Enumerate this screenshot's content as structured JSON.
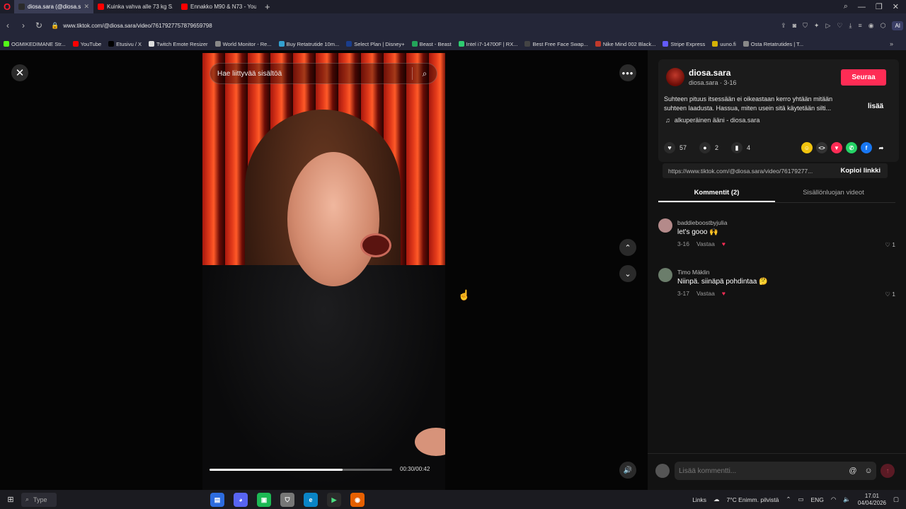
{
  "browser": {
    "tabs": [
      {
        "label": "diosa.sara (@diosa.sa",
        "active": true,
        "color": "#2b2b2b"
      },
      {
        "label": "Kuinka vahva alle 73 kg S...",
        "active": false,
        "color": "#ff0000"
      },
      {
        "label": "Ennakko M90 & N73 - You",
        "active": false,
        "color": "#ff0000"
      }
    ],
    "url": "www.tiktok.com/@diosa.sara/video/7617927757879659798",
    "ai_label": "AI",
    "bookmarks": [
      {
        "label": "OGMIKEDIMANE Str...",
        "color": "#53fc18"
      },
      {
        "label": "YouTube",
        "color": "#ff0000"
      },
      {
        "label": "Etusivu / X",
        "color": "#000000"
      },
      {
        "label": "Twitch Emote Resizer",
        "color": "#dddddd"
      },
      {
        "label": "World Monitor - Re...",
        "color": "#888888"
      },
      {
        "label": "Buy Retatrutide 10m...",
        "color": "#33a0d0"
      },
      {
        "label": "Select Plan | Disney+",
        "color": "#1a3d8c"
      },
      {
        "label": "Beast - Beast",
        "color": "#23a55a"
      },
      {
        "label": "Intel i7-14700F | RX...",
        "color": "#2ecc71"
      },
      {
        "label": "Best Free Face Swap...",
        "color": "#444444"
      },
      {
        "label": "Nike Mind 002 Black...",
        "color": "#c0392b"
      },
      {
        "label": "Stripe Express",
        "color": "#635bff"
      },
      {
        "label": "uuno.fi",
        "color": "#d4b106"
      },
      {
        "label": "Osta Retatrutides | T...",
        "color": "#888888"
      }
    ]
  },
  "viewer": {
    "search_placeholder": "Hae liittyvää sisältöä",
    "timecode": "00:30/00:42",
    "progress_fraction": 0.73
  },
  "author": {
    "name": "diosa.sara",
    "meta": "diosa.sara · 3-16",
    "follow_label": "Seuraa",
    "description": "Suhteen pituus itsessään ei oikeastaan kerro yhtään mitään suhteen laadusta. Hassua, miten usein sitä käytetään silti...",
    "more_label": "lisää",
    "sound": "alkuperäinen ääni - diosa.sara"
  },
  "stats": {
    "likes": "57",
    "comments": "2",
    "saves": "4"
  },
  "share": {
    "url": "https://www.tiktok.com/@diosa.sara/video/76179277...",
    "copy_label": "Kopioi linkki"
  },
  "panel_tabs": {
    "comments": "Kommentit (2)",
    "creator_videos": "Sisällönluojan videot"
  },
  "comments": [
    {
      "user": "baddieboostbyjulia",
      "text": "let's gooo 🙌",
      "date": "3-16",
      "reply": "Vastaa",
      "likes": "1",
      "avatar_color": "#b48a8a"
    },
    {
      "user": "Timo Mäklin",
      "text": "Niinpä. siinäpä pohdintaa 🤔",
      "date": "3-17",
      "reply": "Vastaa",
      "likes": "1",
      "avatar_color": "#6b7d6b"
    }
  ],
  "comment_input": {
    "placeholder": "Lisää kommentti..."
  },
  "taskbar": {
    "search": "Type",
    "links": "Links",
    "weather": "7°C  Enimm. pilvistä",
    "lang": "ENG",
    "time": "17.01",
    "date": "04/04/2026"
  }
}
